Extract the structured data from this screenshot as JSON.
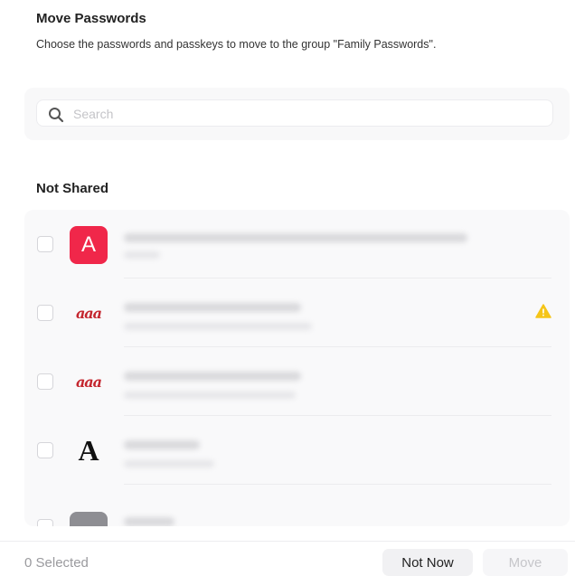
{
  "header": {
    "title": "Move Passwords",
    "subtitle": "Choose the passwords and passkeys to move to the group \"Family Passwords\"."
  },
  "search": {
    "placeholder": "Search",
    "value": ""
  },
  "section": {
    "title": "Not Shared"
  },
  "items": [
    {
      "icon": "A",
      "icon_name": "red-a-app-icon",
      "checked": false,
      "warning": false
    },
    {
      "icon": "aaa",
      "icon_name": "script-logo-icon",
      "checked": false,
      "warning": true
    },
    {
      "icon": "aaa",
      "icon_name": "script-logo-icon",
      "checked": false,
      "warning": false
    },
    {
      "icon": "A",
      "icon_name": "serif-a-logo-icon",
      "checked": false,
      "warning": false
    },
    {
      "icon": "",
      "icon_name": "gray-app-icon",
      "checked": false,
      "warning": false
    }
  ],
  "footer": {
    "selected_label": "0 Selected",
    "not_now_label": "Not Now",
    "move_label": "Move"
  },
  "colors": {
    "accent_red": "#f0274a",
    "warning_yellow": "#f5c518",
    "disabled_text": "#c6c6ca"
  }
}
